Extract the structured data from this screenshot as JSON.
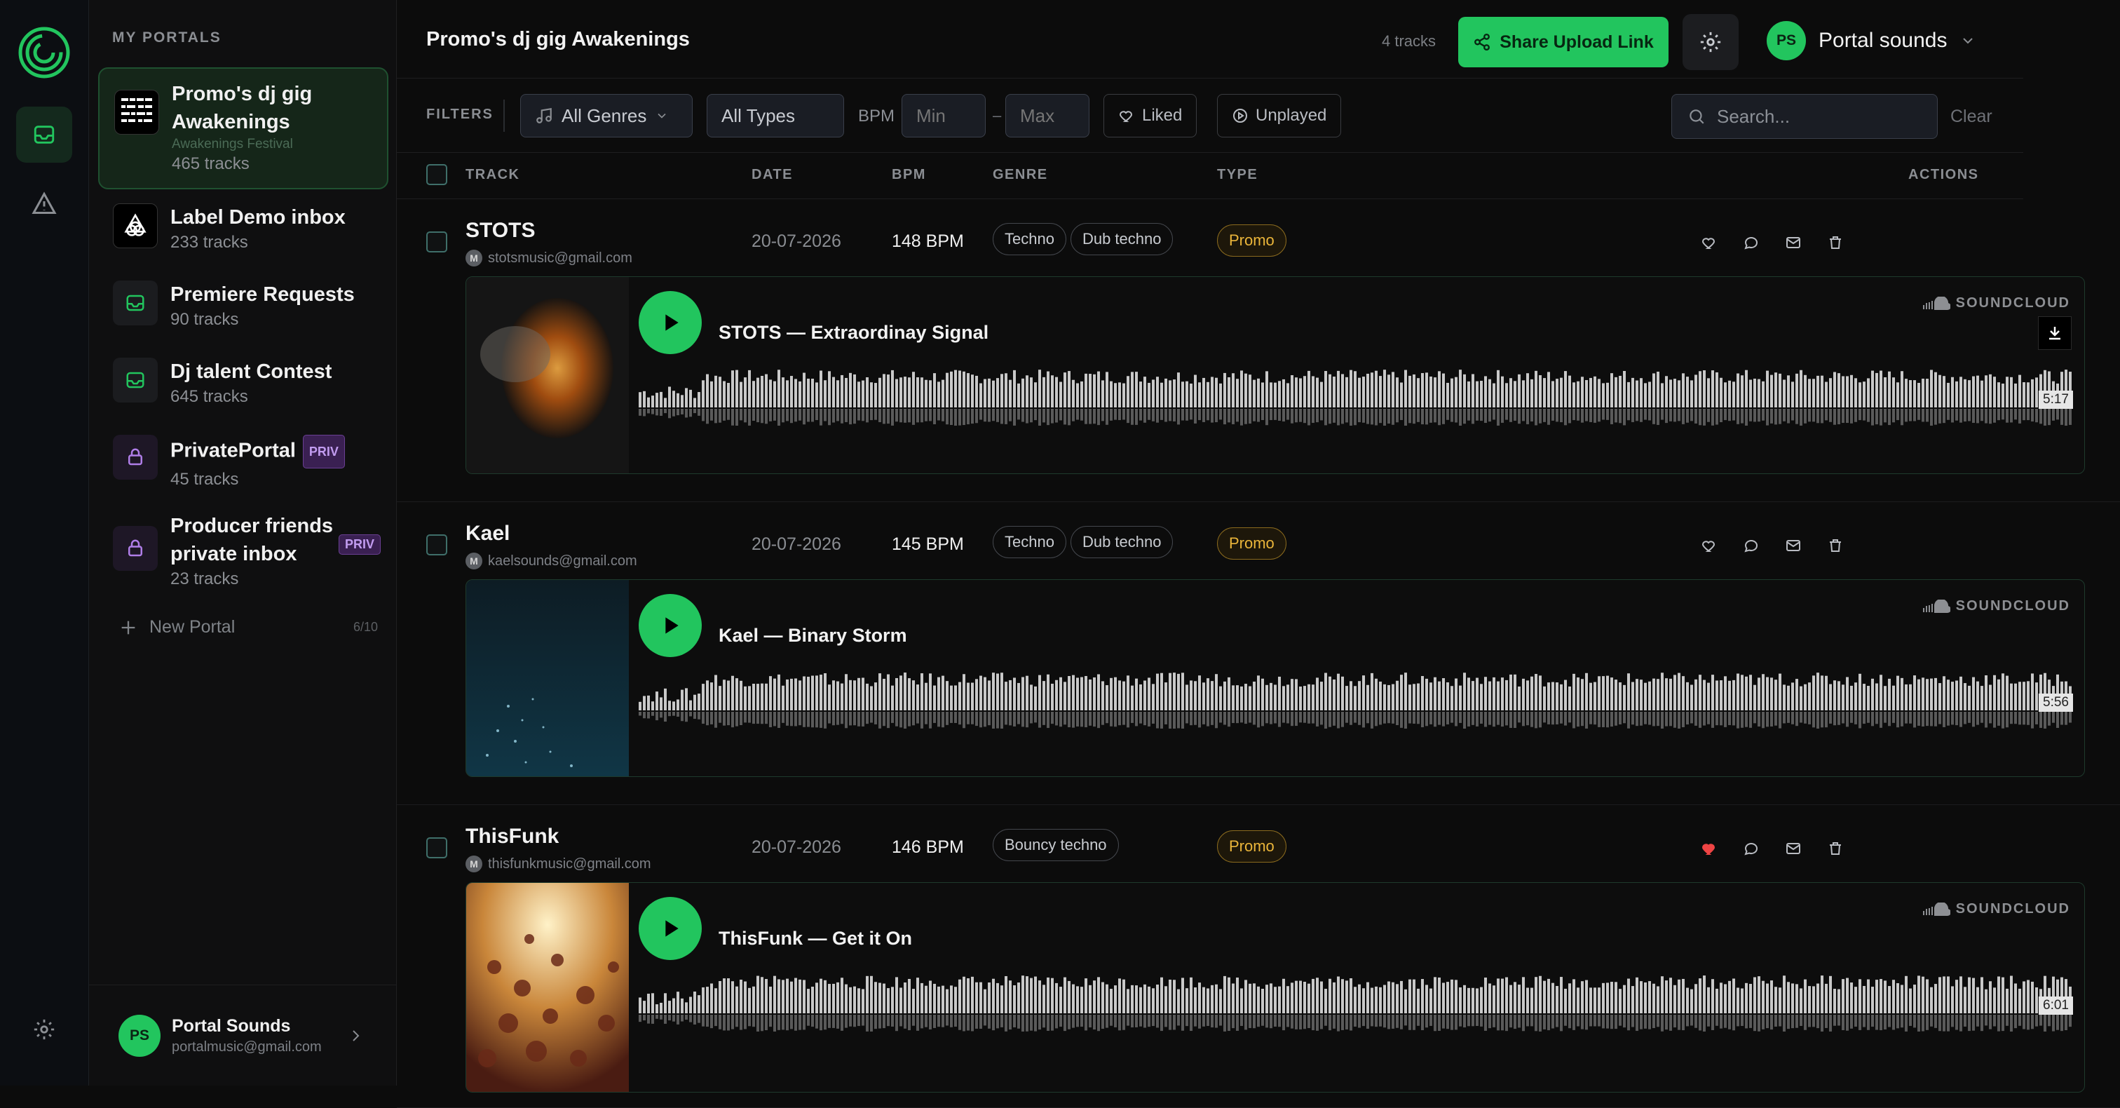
{
  "sidebar": {
    "header": "MY PORTALS",
    "portals": [
      {
        "name": "Promo's dj gig Awakenings",
        "sub": "Awakenings Festival",
        "count": "465 tracks",
        "icon": "awakenings-logo-icon"
      },
      {
        "name": "Label Demo inbox",
        "count": "233 tracks",
        "icon": "triangle-knot-icon"
      },
      {
        "name": "Premiere Requests",
        "count": "90 tracks",
        "icon": "inbox-icon"
      },
      {
        "name": "Dj talent Contest",
        "count": "645 tracks",
        "icon": "inbox-icon"
      },
      {
        "name": "PrivatePortal",
        "badge": "PRIV",
        "count": "45 tracks",
        "icon": "lock-icon"
      },
      {
        "name": "Producer friends private inbox",
        "badge": "PRIV",
        "count": "23 tracks",
        "icon": "lock-icon"
      }
    ],
    "new_portal": "New Portal",
    "portal_limit": "6/10",
    "user": {
      "initials": "PS",
      "name": "Portal Sounds",
      "email": "portalmusic@gmail.com"
    }
  },
  "header": {
    "title": "Promo's dj gig Awakenings",
    "track_count": "4 tracks",
    "share_label": "Share Upload Link",
    "account": {
      "initials": "PS",
      "name": "Portal sounds"
    }
  },
  "filters": {
    "label": "FILTERS",
    "genres": "All Genres",
    "types": "All Types",
    "bpm_label": "BPM",
    "bpm_min_placeholder": "Min",
    "bpm_max_placeholder": "Max",
    "liked": "Liked",
    "unplayed": "Unplayed",
    "search_placeholder": "Search...",
    "clear": "Clear"
  },
  "table": {
    "columns": {
      "track": "TRACK",
      "date": "DATE",
      "bpm": "BPM",
      "genre": "GENRE",
      "type": "TYPE",
      "actions": "ACTIONS"
    },
    "rows": [
      {
        "artist": "STOTS",
        "email": "stotsmusic@gmail.com",
        "date": "20-07-2026",
        "bpm": "148 BPM",
        "genres": [
          "Techno",
          "Dub techno"
        ],
        "type": "Promo",
        "liked": false,
        "player_title": "STOTS — Extraordinay Signal",
        "duration": "5:17",
        "soundcloud": "SOUNDCLOUD"
      },
      {
        "artist": "Kael",
        "email": "kaelsounds@gmail.com",
        "date": "20-07-2026",
        "bpm": "145 BPM",
        "genres": [
          "Techno",
          "Dub techno"
        ],
        "type": "Promo",
        "liked": false,
        "player_title": "Kael — Binary Storm",
        "duration": "5:56",
        "soundcloud": "SOUNDCLOUD"
      },
      {
        "artist": "ThisFunk",
        "email": "thisfunkmusic@gmail.com",
        "date": "20-07-2026",
        "bpm": "146 BPM",
        "genres": [
          "Bouncy techno"
        ],
        "type": "Promo",
        "liked": true,
        "player_title": "ThisFunk — Get it On",
        "duration": "6:01",
        "soundcloud": "SOUNDCLOUD"
      }
    ]
  },
  "colors": {
    "accent": "#22c55e",
    "liked": "#ef4444",
    "promo": "#eab53a",
    "priv": "#c29cf0"
  }
}
